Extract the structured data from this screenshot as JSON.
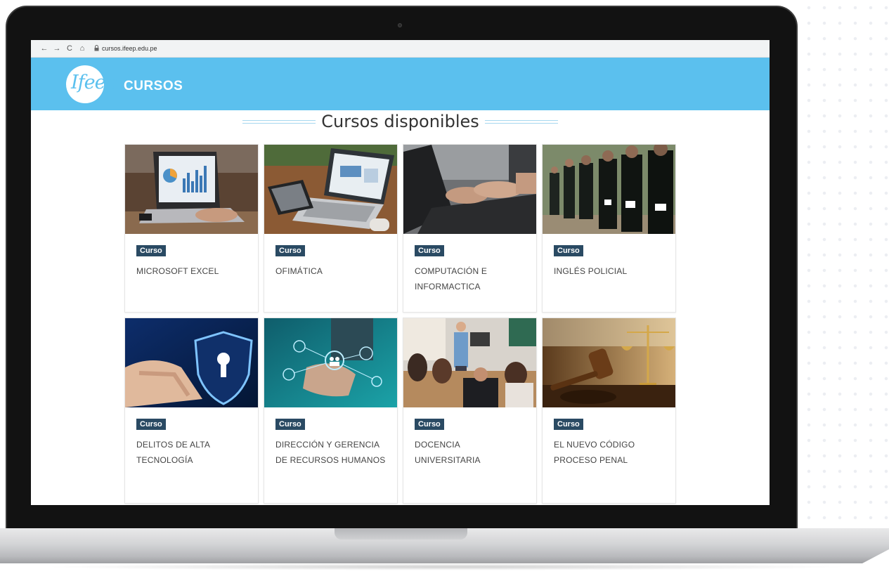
{
  "browser": {
    "back": "←",
    "forward": "→",
    "reload": "C",
    "home": "⌂",
    "lock": "🔒",
    "url": "cursos.ifeep.edu.pe"
  },
  "header": {
    "logo_text": "Ifeep",
    "logo_suffix": "CURSOS",
    "brand_color": "#5bc0ee"
  },
  "section": {
    "title": "Cursos disponibles"
  },
  "badge_color": "#2a4a63",
  "courses": [
    {
      "badge": "Curso",
      "title": "MICROSOFT EXCEL",
      "image": "laptop-charts"
    },
    {
      "badge": "Curso",
      "title": "OFIMÁTICA",
      "image": "laptop-tablet-desk"
    },
    {
      "badge": "Curso",
      "title": "COMPUTACIÓN E INFORMACTICA",
      "image": "typing-laptop"
    },
    {
      "badge": "Curso",
      "title": "INGLÉS POLICIAL",
      "image": "police-parade"
    },
    {
      "badge": "Curso",
      "title": "DELITOS DE ALTA TECNOLOGÍA",
      "image": "cyber-security-shield"
    },
    {
      "badge": "Curso",
      "title": "DIRECCIÓN Y GERENCIA DE RECURSOS HUMANOS",
      "image": "hr-network"
    },
    {
      "badge": "Curso",
      "title": "DOCENCIA UNIVERSITARIA",
      "image": "classroom-teacher"
    },
    {
      "badge": "Curso",
      "title": "EL NUEVO CÓDIGO PROCESO PENAL",
      "image": "judge-gavel"
    }
  ]
}
